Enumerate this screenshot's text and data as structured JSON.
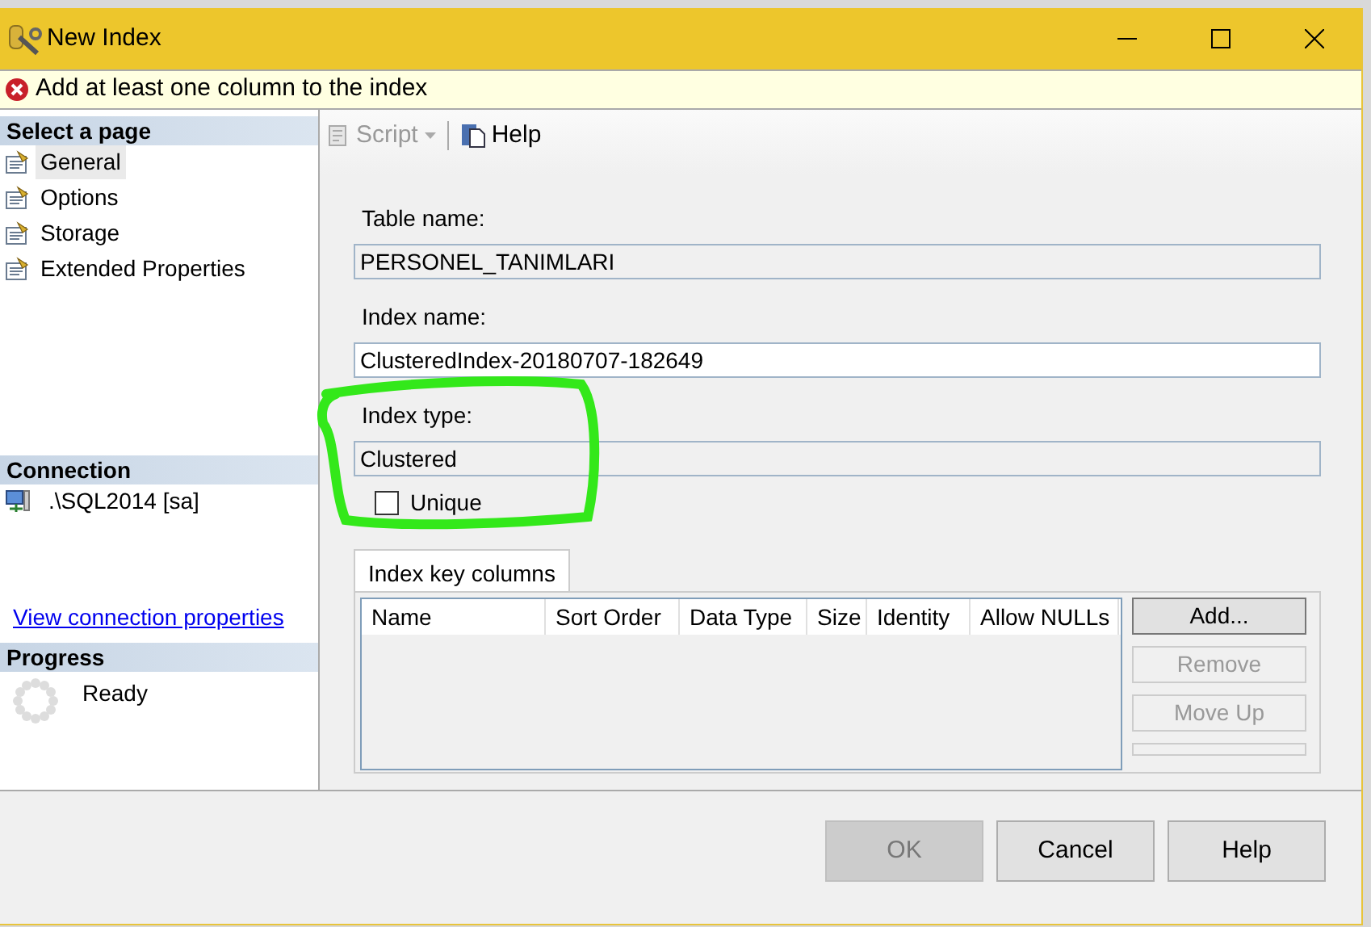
{
  "window": {
    "title": "New Index"
  },
  "error": {
    "message": "Add at least one column to the index"
  },
  "sidebar": {
    "select_page": {
      "header": "Select a page",
      "items": [
        {
          "label": "General",
          "selected": true
        },
        {
          "label": "Options",
          "selected": false
        },
        {
          "label": "Storage",
          "selected": false
        },
        {
          "label": "Extended Properties",
          "selected": false
        }
      ]
    },
    "connection": {
      "header": "Connection",
      "server": ".\\SQL2014 [sa]",
      "link": "View connection properties"
    },
    "progress": {
      "header": "Progress",
      "status": "Ready"
    }
  },
  "toolbar": {
    "script": {
      "label": "Script",
      "disabled": true
    },
    "help": {
      "label": "Help",
      "disabled": false
    }
  },
  "form": {
    "fields": [
      {
        "label": "Table name:",
        "value": "PERSONEL_TANIMLARI",
        "disabled": true
      },
      {
        "label": "Index name:",
        "value": "ClusteredIndex-20180707-182649",
        "disabled": false
      },
      {
        "label": "Index type:",
        "value": "Clustered",
        "disabled": true
      }
    ],
    "unique": {
      "label": "Unique",
      "checked": false
    }
  },
  "tabs": [
    {
      "label": "Index key columns",
      "selected": true
    }
  ],
  "table": {
    "columns": [
      "Name",
      "Sort Order",
      "Data Type",
      "Size",
      "Identity",
      "Allow NULLs"
    ]
  },
  "side_buttons": [
    {
      "label": "Add...",
      "disabled": false
    },
    {
      "label": "Remove",
      "disabled": true
    },
    {
      "label": "Move Up",
      "disabled": true
    }
  ],
  "buttons": [
    {
      "label": "OK",
      "disabled": true
    },
    {
      "label": "Cancel",
      "disabled": false
    },
    {
      "label": "Help",
      "disabled": false
    }
  ]
}
